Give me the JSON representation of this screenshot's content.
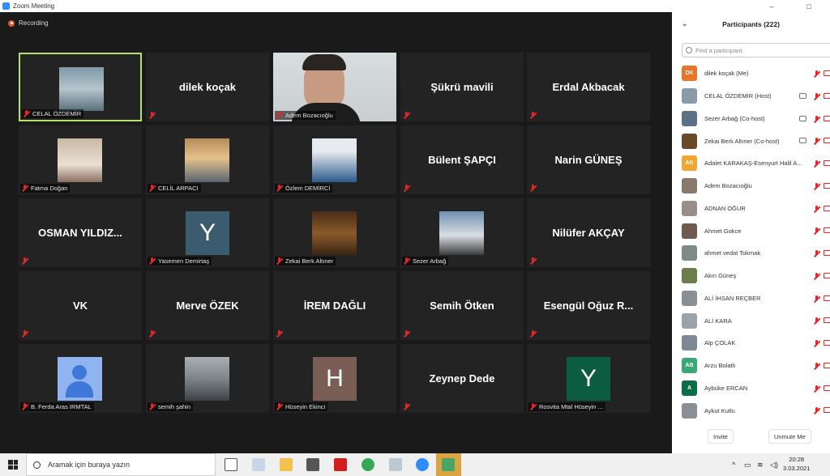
{
  "window": {
    "title": "Zoom Meeting",
    "minimize": "–",
    "maximize": "□"
  },
  "recording": {
    "label": "Recording"
  },
  "tiles": [
    {
      "name": "CELAL ÖZDEMİR",
      "type": "photo",
      "photo": "airplane",
      "active": true
    },
    {
      "name": "dilek koçak",
      "type": "text"
    },
    {
      "name": "Adem Bozacıoğlu",
      "type": "video"
    },
    {
      "name": "Şükrü mavili",
      "type": "text"
    },
    {
      "name": "Erdal Akbacak",
      "type": "text"
    },
    {
      "name": "Fatma Doğan",
      "type": "photo",
      "photo": "person-desk"
    },
    {
      "name": "CELİL ARPACI",
      "type": "photo",
      "photo": "sunset-sea"
    },
    {
      "name": "Özlem DEMİRCİ",
      "type": "photo",
      "photo": "woman-blue"
    },
    {
      "name": "Bülent ŞAPÇI",
      "type": "text"
    },
    {
      "name": "Narin GÜNEŞ",
      "type": "text"
    },
    {
      "name": "OSMAN YILDIZ...",
      "type": "text"
    },
    {
      "name": "Yasemen Demirtaş",
      "type": "letter",
      "letter": "Y",
      "color": "#3b5b6e"
    },
    {
      "name": "Zekai Berk Altıner",
      "type": "photo",
      "photo": "brown-text"
    },
    {
      "name": "Sezer Arbağ",
      "type": "photo",
      "photo": "man-street"
    },
    {
      "name": "Nilüfer AKÇAY",
      "type": "text"
    },
    {
      "name": "VK",
      "type": "text"
    },
    {
      "name": "Merve ÖZEK",
      "type": "text"
    },
    {
      "name": "İREM DAĞLI",
      "type": "text"
    },
    {
      "name": "Semih Ötken",
      "type": "text"
    },
    {
      "name": "Esengül Oğuz R...",
      "type": "text"
    },
    {
      "name": "B. Ferda Aras IRMTAL",
      "type": "avatar-default"
    },
    {
      "name": "semih şahin",
      "type": "photo",
      "photo": "man-car"
    },
    {
      "name": "Hüseyin Ekinci",
      "type": "letter",
      "letter": "H",
      "color": "#7a5e56"
    },
    {
      "name": "Zeynep Dede",
      "type": "text"
    },
    {
      "name": "Rosvita Mtal Hüseyin ...",
      "type": "letter",
      "letter": "Y",
      "color": "#0c5c42"
    }
  ],
  "tile_big_names": [
    1,
    3,
    4,
    8,
    9,
    10,
    14,
    15,
    16,
    17,
    18,
    19,
    23
  ],
  "participants_panel": {
    "title": "Participants (222)",
    "search_placeholder": "Find a participant",
    "list": [
      {
        "name": "dilek koçak (Me)",
        "initials": "DK",
        "color": "#e8752a"
      },
      {
        "name": "CELAL ÖZDEMİR (Host)",
        "initials": "",
        "color": "#8a9aa6"
      },
      {
        "name": "Sezer Arbağ (Co-host)",
        "initials": "",
        "color": "#5d7185"
      },
      {
        "name": "Zekai Berk Altıner (Co-host)",
        "initials": "",
        "color": "#6b4a2a"
      },
      {
        "name": "Adalet KARAKAŞ-Esenyurt Halil A...",
        "initials": "AK",
        "color": "#f0a630"
      },
      {
        "name": "Adem Bozacıoğlu",
        "initials": "",
        "color": "#8a7a6c"
      },
      {
        "name": "ADNAN OĞUR",
        "initials": "",
        "color": "#9a8e8a"
      },
      {
        "name": "Ahmet Gokce",
        "initials": "",
        "color": "#6e5a4e"
      },
      {
        "name": "ahmet vedat Tokmak",
        "initials": "",
        "color": "#7f8a86"
      },
      {
        "name": "Akın Güneş",
        "initials": "",
        "color": "#6c7d4c"
      },
      {
        "name": "ALİ İHSAN REÇBER",
        "initials": "",
        "color": "#8a8f96"
      },
      {
        "name": "ALİ KARA",
        "initials": "",
        "color": "#9aa2aa"
      },
      {
        "name": "Alp ÇOLAK",
        "initials": "",
        "color": "#7c8893"
      },
      {
        "name": "Arzu Bolatlı",
        "initials": "AB",
        "color": "#3aa876"
      },
      {
        "name": "Aybüke ERCAN",
        "initials": "A",
        "color": "#0b6e48"
      },
      {
        "name": "Aykut Kutlu",
        "initials": "",
        "color": "#8a8f96"
      }
    ],
    "invite_label": "Invite",
    "unmute_label": "Unmute Me"
  },
  "taskbar": {
    "search_placeholder": "Aramak için buraya yazın",
    "time": "20:28",
    "date": "3.03.2021"
  }
}
